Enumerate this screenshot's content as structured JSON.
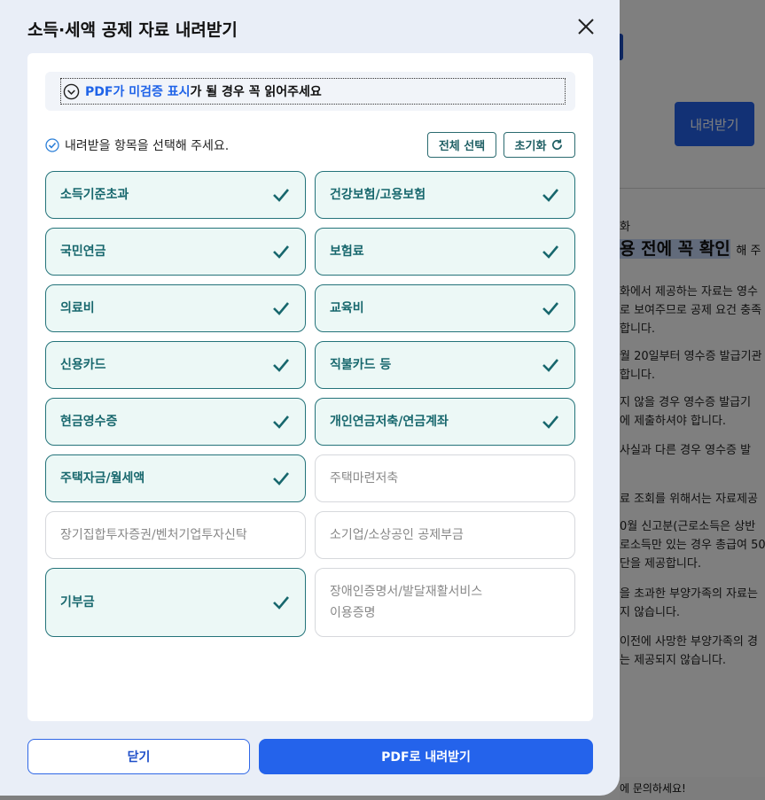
{
  "background": {
    "download_label": "내려받기",
    "small_label": "화",
    "heading_highlight": "용 전에 꼭 확인",
    "heading_tail": "해 주",
    "paragraphs": [
      [
        "화에서 제공하는 자료는 영수",
        "로 보여주므로 공제 요건 충족",
        "합니다."
      ],
      [
        "월 20일부터 영수증 발급기관",
        "합니다."
      ],
      [
        "지 않을 경우 영수증 발급기",
        "에 제출하셔야 합니다."
      ],
      [
        "사실과 다른 경우 영수증 발"
      ],
      [
        "료 조회를 위해서는 자료제공"
      ],
      [
        "0월 신고분(근로소득은 상반",
        "로소득만 있는 경우 총급여 50",
        "단을 제공합니다."
      ],
      [
        "을 초과한 부양가족의 자료는",
        "지 않습니다."
      ],
      [
        "이전에 사망한 부양가족의 경",
        "는 제공되지 않습니다."
      ]
    ],
    "bottom_text": "에 문의하세요!"
  },
  "modal": {
    "title": "소득·세액 공제 자료 내려받기",
    "notice_highlight": "PDF가 미검증 표시",
    "notice_rest": "가 될 경우 꼭 읽어주세요",
    "select_label": "내려받을 항목을 선택해 주세요.",
    "select_all_label": "전체 선택",
    "reset_label": "초기화",
    "items": [
      {
        "label": "소득기준초과",
        "checked": true
      },
      {
        "label": "건강보험/고용보험",
        "checked": true
      },
      {
        "label": "국민연금",
        "checked": true
      },
      {
        "label": "보험료",
        "checked": true
      },
      {
        "label": "의료비",
        "checked": true
      },
      {
        "label": "교육비",
        "checked": true
      },
      {
        "label": "신용카드",
        "checked": true
      },
      {
        "label": "직불카드 등",
        "checked": true
      },
      {
        "label": "현금영수증",
        "checked": true
      },
      {
        "label": "개인연금저축/연금계좌",
        "checked": true
      },
      {
        "label": "주택자금/월세액",
        "checked": true
      },
      {
        "label": "주택마련저축",
        "checked": false
      },
      {
        "label": "장기집합투자증권/벤처기업투자신탁",
        "checked": false
      },
      {
        "label": "소기업/소상공인 공제부금",
        "checked": false
      },
      {
        "label": "기부금",
        "checked": true
      },
      {
        "label": "장애인증명서/발달재활서비스\n이용증명",
        "checked": false
      }
    ],
    "close_label": "닫기",
    "pdf_label": "PDF로 내려받기"
  },
  "colors": {
    "accent": "#2463eb",
    "checked_border": "#24737a",
    "checked_bg": "#ecf8f6",
    "checked_text": "#17676d"
  },
  "icons": [
    "close-icon",
    "chevron-down-circle-icon",
    "checkbox-check-icon",
    "refresh-icon",
    "check-icon"
  ]
}
